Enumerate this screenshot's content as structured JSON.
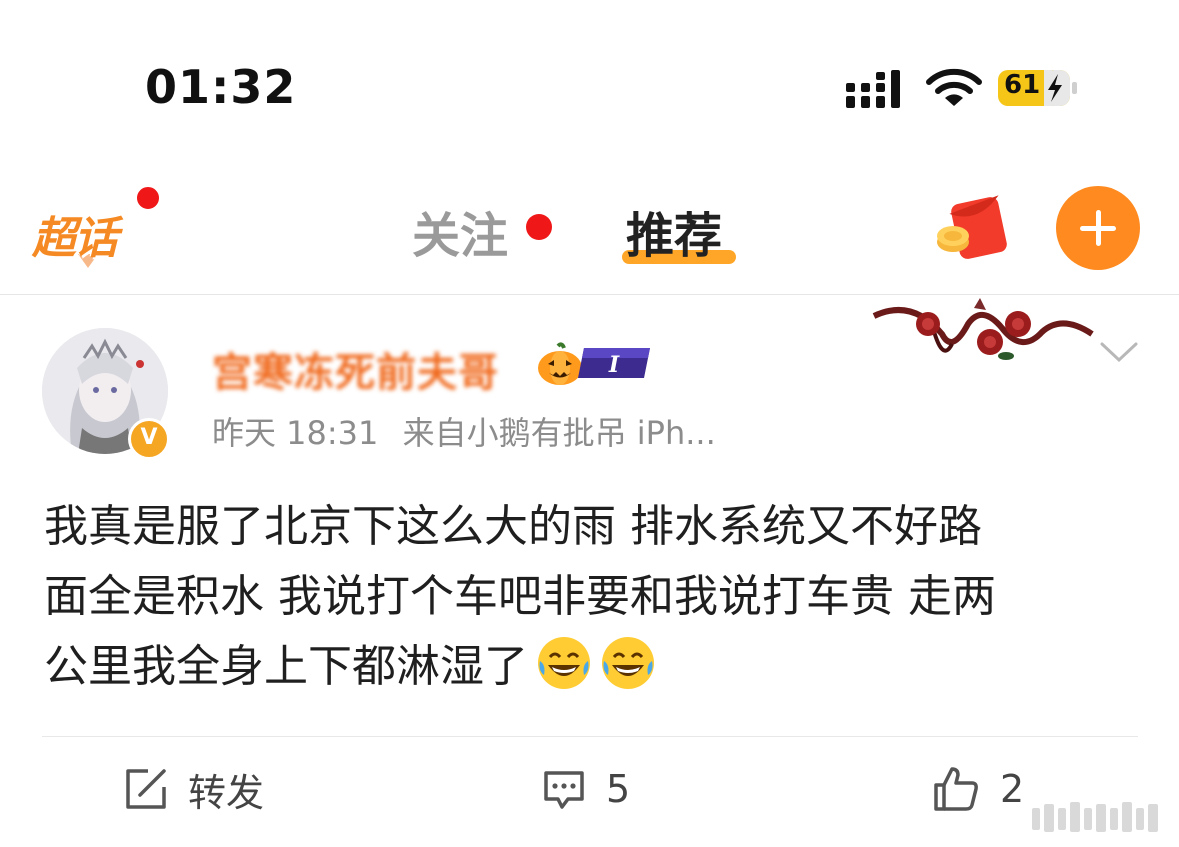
{
  "status_bar": {
    "time": "01:32",
    "battery": "61",
    "battery_color": "#f5c518",
    "icons": [
      "cellular-signal-icon",
      "wifi-icon",
      "battery-charging-icon"
    ]
  },
  "nav": {
    "supertopic_label": "超话",
    "tabs": [
      {
        "label": "关注",
        "active": false,
        "has_dot": true
      },
      {
        "label": "推荐",
        "active": true
      }
    ],
    "accent_color": "#ff8a1f",
    "actions": [
      "red-packet-icon",
      "plus-icon"
    ]
  },
  "post": {
    "username": "宫寒冻死前夫哥",
    "verified_badge": "V",
    "level_badge": "I",
    "time": "昨天 18:31",
    "source": "来自小鹅有批吊 iPh...",
    "content_lines": [
      "我真是服了北京下这么大的雨 排水系统又不好路",
      "面全是积水 我说打个车吧非要和我说打车贵 走两",
      "公里我全身上下都淋湿了"
    ],
    "content_emojis": [
      "tears-of-joy-emoji",
      "tears-of-joy-emoji"
    ]
  },
  "actions": {
    "repost_label": "转发",
    "comment_count": "5",
    "like_count": "2"
  }
}
